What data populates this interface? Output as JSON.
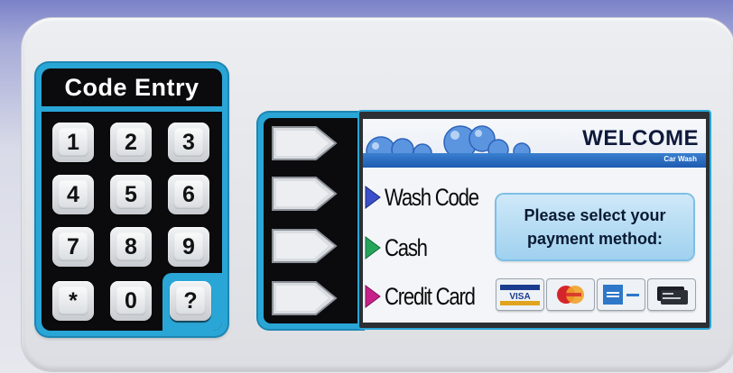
{
  "keypad": {
    "title": "Code Entry",
    "keys": [
      "1",
      "2",
      "3",
      "4",
      "5",
      "6",
      "7",
      "8",
      "9",
      "*",
      "0",
      "?"
    ]
  },
  "screen": {
    "header": {
      "title": "WELCOME",
      "subtitle": "Car Wash"
    },
    "menu": [
      {
        "label": "Wash Code",
        "arrow_color": "#3a4fc9"
      },
      {
        "label": "Cash",
        "arrow_color": "#25a55a"
      },
      {
        "label": "Credit Card",
        "arrow_color": "#c8208a"
      }
    ],
    "prompt": {
      "line1": "Please select your",
      "line2": "payment method:"
    },
    "cards": [
      {
        "name": "visa-card-icon",
        "text": "VISA"
      },
      {
        "name": "mastercard-icon",
        "text": ""
      },
      {
        "name": "amex-card-icon",
        "text": ""
      },
      {
        "name": "card-reader-icon",
        "text": ""
      }
    ]
  },
  "colors": {
    "accent_blue": "#2aa6d6",
    "key_dark": "#0b0b0d",
    "banner_blue": "#1e5bb0"
  }
}
